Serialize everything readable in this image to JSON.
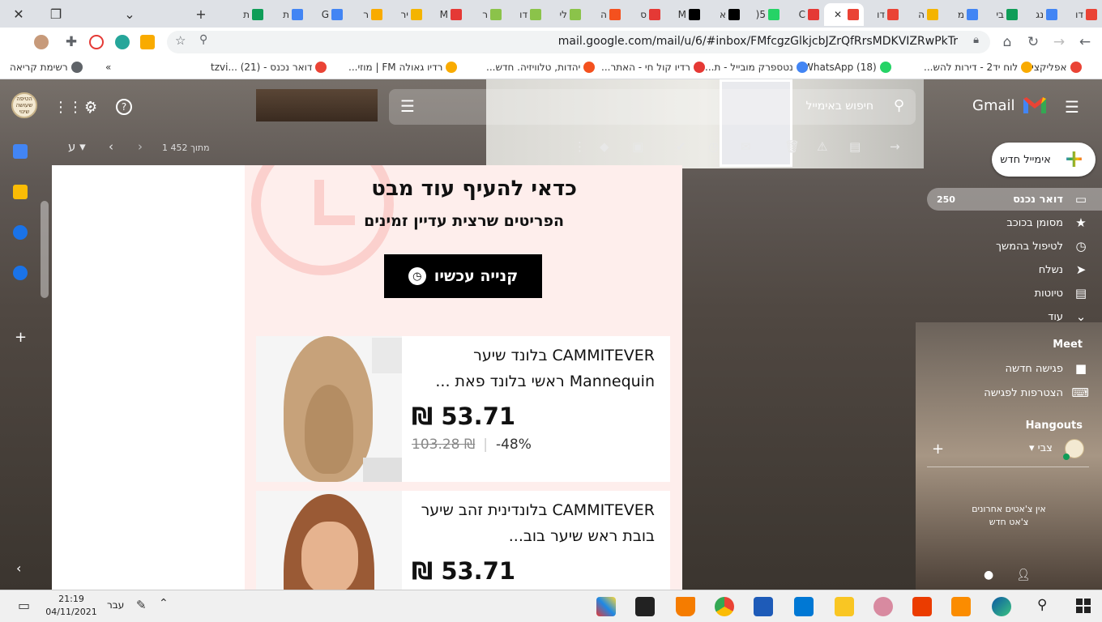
{
  "browser": {
    "tabs": [
      {
        "label": "דו",
        "color": "#ea4335"
      },
      {
        "label": "נג",
        "color": "#4285f4"
      },
      {
        "label": "בי",
        "color": "#0f9d58"
      },
      {
        "label": "מ",
        "color": "#4285f4"
      },
      {
        "label": "ה",
        "color": "#f4b400"
      },
      {
        "label": "דו",
        "color": "#ea4335"
      },
      {
        "label": "",
        "color": "#ea4335",
        "active": true
      },
      {
        "label": "C",
        "color": "#e53935"
      },
      {
        "label": "5(",
        "color": "#25d366"
      },
      {
        "label": "א",
        "color": "#000000"
      },
      {
        "label": "M",
        "color": "#000000"
      },
      {
        "label": "ס",
        "color": "#e53935"
      },
      {
        "label": "ה",
        "color": "#f4511e"
      },
      {
        "label": "לי",
        "color": "#8bc34a"
      },
      {
        "label": "דו",
        "color": "#8bc34a"
      },
      {
        "label": "ר",
        "color": "#8bc34a"
      },
      {
        "label": "M",
        "color": "#e53935"
      },
      {
        "label": "יר",
        "color": "#f4b400"
      },
      {
        "label": "ר",
        "color": "#f9ab00"
      },
      {
        "label": "G",
        "color": "#4285f4"
      },
      {
        "label": "ת",
        "color": "#4285f4"
      },
      {
        "label": "ת",
        "color": "#0f9d58"
      }
    ],
    "url": "mail.google.com/mail/u/6/#inbox/FMfcgzGlkjcbJZrQfRrsMDKVIZRwPkTr",
    "bookmarks": [
      {
        "label": "אפליקציות",
        "color": "#ea4335"
      },
      {
        "label": "לוח יד2 - דירות להש...",
        "color": "#f9ab00"
      },
      {
        "label": "(18) WhatsApp",
        "color": "#25d366"
      },
      {
        "label": "נטספרק מובייל - ת...",
        "color": "#4285f4"
      },
      {
        "label": "רדיו קול חי - האתר...",
        "color": "#e53935"
      },
      {
        "label": "יהדות, טלוויזיה. חדש...",
        "color": "#f4511e"
      },
      {
        "label": "רדיו גאולה FM | מוזי...",
        "color": "#f9ab00"
      },
      {
        "label": "דואר נכנס - tzvi... (21)",
        "color": "#ea4335"
      },
      {
        "label": "»",
        "color": ""
      },
      {
        "label": "רשימת קריאה",
        "color": "#5f6368"
      }
    ]
  },
  "gmail": {
    "logo_text": "Gmail",
    "search_placeholder": "חיפוש באימייל",
    "avatar_text": "הטיפה שעושה שינוי",
    "toolbar": {
      "range": "1 מתוך 452",
      "input_lang": "ע"
    },
    "compose_label": "אימייל חדש",
    "nav": [
      {
        "label": "דואר נכנס",
        "icon": "inbox-icon",
        "glyph": "▭",
        "count": "250",
        "selected": true
      },
      {
        "label": "מסומן בכוכב",
        "icon": "star-icon",
        "glyph": "★"
      },
      {
        "label": "לטיפול בהמשך",
        "icon": "snooze-icon",
        "glyph": "◷"
      },
      {
        "label": "נשלח",
        "icon": "send-icon",
        "glyph": "➤"
      },
      {
        "label": "טיוטות",
        "icon": "draft-icon",
        "glyph": "▤"
      },
      {
        "label": "עוד",
        "icon": "chevron-down-icon",
        "glyph": "⌄"
      }
    ],
    "meet": {
      "title": "Meet",
      "items": [
        {
          "label": "פגישה חדשה",
          "icon": "video-icon",
          "glyph": "■"
        },
        {
          "label": "הצטרפות לפגישה",
          "icon": "keyboard-icon",
          "glyph": "⌨"
        }
      ]
    },
    "hangouts": {
      "title": "Hangouts",
      "user": "צבי",
      "no_chats": "אין צ'אטים אחרונים",
      "new_chat": "צ'אט חדש"
    }
  },
  "email": {
    "promo_title": "כדאי להעיף עוד מבט",
    "promo_subtitle": "הפריטים שרצית עדיין זמינים",
    "buy_button": "קנייה עכשיו",
    "products": [
      {
        "title": "CAMMITEVER בלונד שיער Mannequin ראשי בלונד פאת ...",
        "price": "53.71 ₪",
        "old_price": "103.28 ₪",
        "discount": "-48%",
        "hair_color": "#c7a27a"
      },
      {
        "title": "CAMMITEVER בלונדינית זהב שיער בובת ראש שיער בוב...",
        "price": "53.71 ₪",
        "old_price": "",
        "discount": "",
        "hair_color": "#9a5a35"
      }
    ]
  },
  "taskbar": {
    "time": "21:19",
    "date": "04/11/2021",
    "lang": "עבר"
  }
}
